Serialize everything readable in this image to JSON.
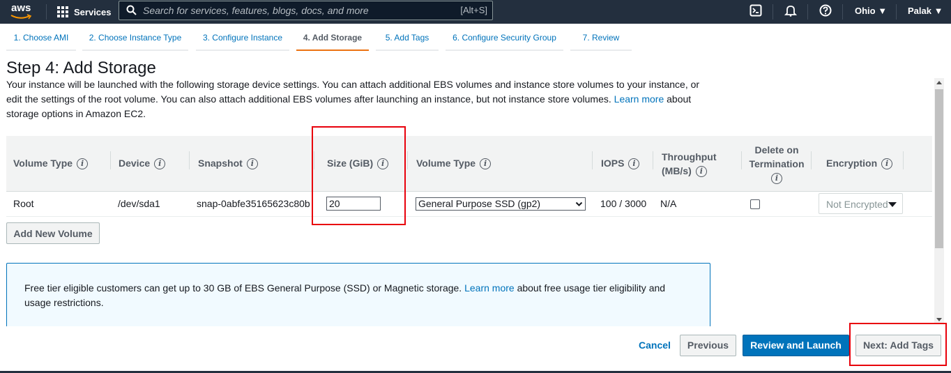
{
  "colors": {
    "nav_bg": "#232f3e",
    "link": "#0073bb",
    "primary": "#0073bb",
    "active_tab": "#ec7211",
    "highlight": "#e8000b"
  },
  "nav": {
    "logo": "aws",
    "services": "Services",
    "search_placeholder": "Search for services, features, blogs, docs, and more",
    "search_shortcut": "[Alt+S]",
    "icons": [
      "cloudshell-icon",
      "bell-icon",
      "help-icon"
    ],
    "region": "Ohio ▼",
    "user": "Palak ▼"
  },
  "wizard_tabs": [
    {
      "label": "1. Choose AMI",
      "active": false
    },
    {
      "label": "2. Choose Instance Type",
      "active": false
    },
    {
      "label": "3. Configure Instance",
      "active": false
    },
    {
      "label": "4. Add Storage",
      "active": true
    },
    {
      "label": "5. Add Tags",
      "active": false
    },
    {
      "label": "6. Configure Security Group",
      "active": false
    },
    {
      "label": "7. Review",
      "active": false
    }
  ],
  "page": {
    "title": "Step 4: Add Storage",
    "desc_1": "Your instance will be launched with the following storage device settings. You can attach additional EBS volumes and instance store volumes to your instance, or edit the settings of the root volume. You can also attach additional EBS volumes after launching an instance, but not instance store volumes.",
    "desc_link": "Learn more",
    "desc_2": "about storage options in Amazon EC2."
  },
  "table": {
    "headers": {
      "volume_type": "Volume Type",
      "device": "Device",
      "snapshot": "Snapshot",
      "size": "Size (GiB)",
      "volume_type_2": "Volume Type",
      "iops": "IOPS",
      "throughput_1": "Throughput",
      "throughput_2": "(MB/s)",
      "delete_1": "Delete on",
      "delete_2": "Termination",
      "encryption": "Encryption"
    },
    "row": {
      "volume_type": "Root",
      "device": "/dev/sda1",
      "snapshot": "snap-0abfe35165623c80b",
      "size": "20",
      "volume_type_select": "General Purpose SSD (gp2)",
      "iops": "100 / 3000",
      "throughput": "N/A",
      "delete_on_termination": false,
      "encryption": "Not Encrypted"
    }
  },
  "add_volume_button": "Add New Volume",
  "info": {
    "text_1": "Free tier eligible customers can get up to 30 GB of EBS General Purpose (SSD) or Magnetic storage.",
    "link": "Learn more",
    "text_2": "about free usage tier eligibility and usage restrictions."
  },
  "footer": {
    "cancel": "Cancel",
    "previous": "Previous",
    "review": "Review and Launch",
    "next": "Next: Add Tags"
  }
}
